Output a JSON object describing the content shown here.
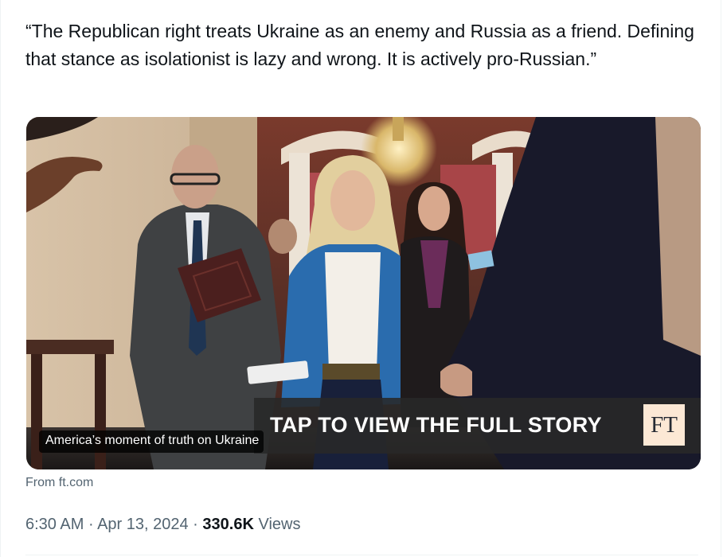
{
  "tweet": {
    "text": "“The Republican right treats Ukraine as an enemy and Russia as a friend. Defining that stance as isolationist is lazy and wrong. It is actively pro-Russian.”"
  },
  "card": {
    "banner_text": "TAP TO VIEW THE FULL STORY",
    "logo_text": "FT",
    "caption": "America’s moment of truth on Ukraine",
    "source": "From ft.com"
  },
  "meta": {
    "time": "6:30 AM",
    "separator": "·",
    "date": "Apr 13, 2024",
    "views_count": "330.6K",
    "views_label": "Views"
  },
  "colors": {
    "text_primary": "#0f1419",
    "text_secondary": "#536471",
    "ft_salmon": "#fce8d5",
    "banner_bg": "#282828"
  }
}
